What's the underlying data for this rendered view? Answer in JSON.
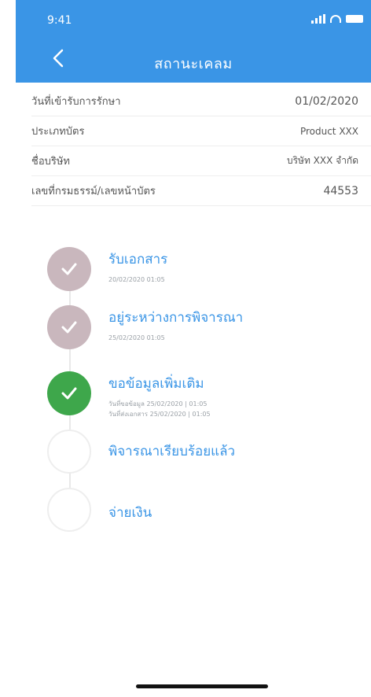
{
  "status": {
    "time": "9:41"
  },
  "header": {
    "title": "สถานะเคลม"
  },
  "info": [
    {
      "label": "วันที่เข้ารับการรักษา",
      "value": "01/02/2020"
    },
    {
      "label": "ประเภทบัตร",
      "value": "Product XXX"
    },
    {
      "label": "ชื่อบริษัท",
      "value": "บริษัท XXX จำกัด"
    },
    {
      "label": "เลขที่กรมธรรม์/เลขหน้าบัตร",
      "value": "44553"
    }
  ],
  "steps": [
    {
      "title": "รับเอกสาร",
      "sub1": "20/02/2020 01:05",
      "sub2": "",
      "state": "done"
    },
    {
      "title": "อยู่ระหว่างการพิจารณา",
      "sub1": "25/02/2020 01:05",
      "sub2": "",
      "state": "done"
    },
    {
      "title": "ขอข้อมูลเพิ่มเติม",
      "sub1": "วันที่ขอข้อมูล 25/02/2020 | 01:05",
      "sub2": "วันที่ส่งเอกสาร 25/02/2020 | 01:05",
      "state": "active"
    },
    {
      "title": "พิจารณาเรียบร้อยแล้ว",
      "sub1": "",
      "sub2": "",
      "state": "pending"
    },
    {
      "title": "จ่ายเงิน",
      "sub1": "",
      "sub2": "",
      "state": "pending"
    }
  ],
  "colors": {
    "header": "#3a95e6",
    "done": "#c9b7bd",
    "active": "#3ea74b",
    "stepTitle": "#3a95e6"
  },
  "icons": {
    "back": "chevron-left-icon",
    "check": "check-icon"
  }
}
